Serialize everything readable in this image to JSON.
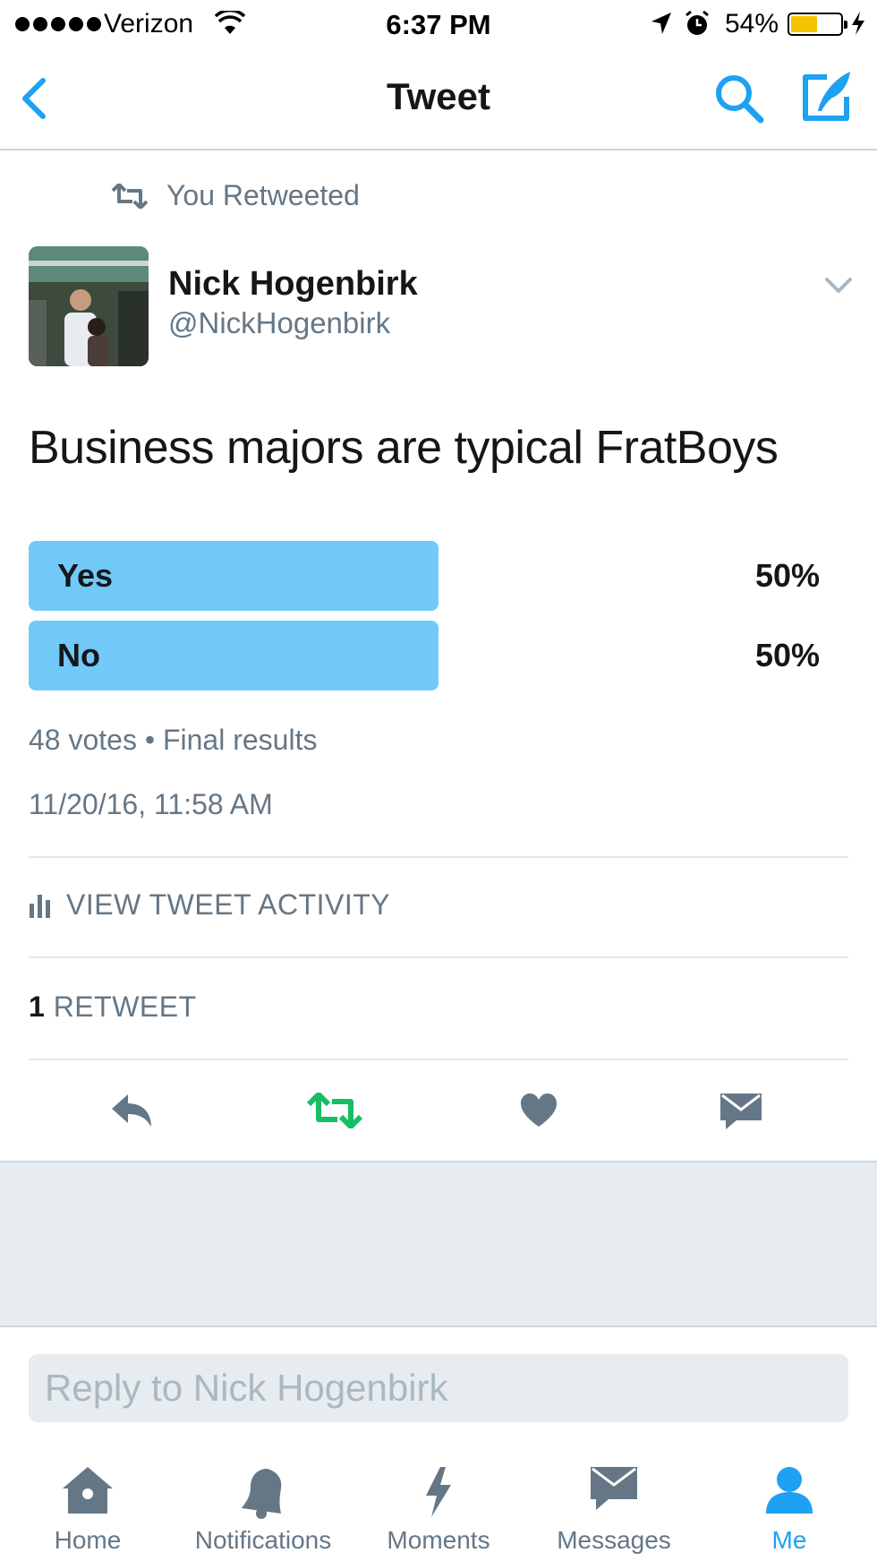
{
  "status_bar": {
    "carrier": "Verizon",
    "time": "6:37 PM",
    "battery_percent": "54%",
    "battery_level": 0.54,
    "signal_bars": 5
  },
  "nav": {
    "title": "Tweet",
    "back_icon": "chevron-left-icon",
    "search_icon": "search-icon",
    "compose_icon": "compose-icon"
  },
  "tweet": {
    "retweet_context": "You Retweeted",
    "author_name": "Nick Hogenbirk",
    "author_handle": "@NickHogenbirk",
    "text": "Business majors are typical FratBoys",
    "poll": {
      "options": [
        {
          "label": "Yes",
          "percent": "50%",
          "value": 0.5
        },
        {
          "label": "No",
          "percent": "50%",
          "value": 0.5
        }
      ],
      "votes": "48 votes",
      "separator": "•",
      "status": "Final results"
    },
    "timestamp": "11/20/16, 11:58 AM",
    "activity_label": "VIEW TWEET ACTIVITY",
    "retweet_count": "1",
    "retweet_label": "RETWEET"
  },
  "reply": {
    "placeholder": "Reply to Nick Hogenbirk"
  },
  "tabs": [
    {
      "label": "Home",
      "icon": "home-icon",
      "active": false
    },
    {
      "label": "Notifications",
      "icon": "bell-icon",
      "active": false
    },
    {
      "label": "Moments",
      "icon": "lightning-icon",
      "active": false
    },
    {
      "label": "Messages",
      "icon": "envelope-icon",
      "active": false
    },
    {
      "label": "Me",
      "icon": "person-icon",
      "active": true
    }
  ],
  "colors": {
    "accent": "#1da1f2",
    "poll_bar": "#71c9f8",
    "muted": "#657786",
    "retweet_green": "#17bf63",
    "action_grey": "#657786"
  }
}
